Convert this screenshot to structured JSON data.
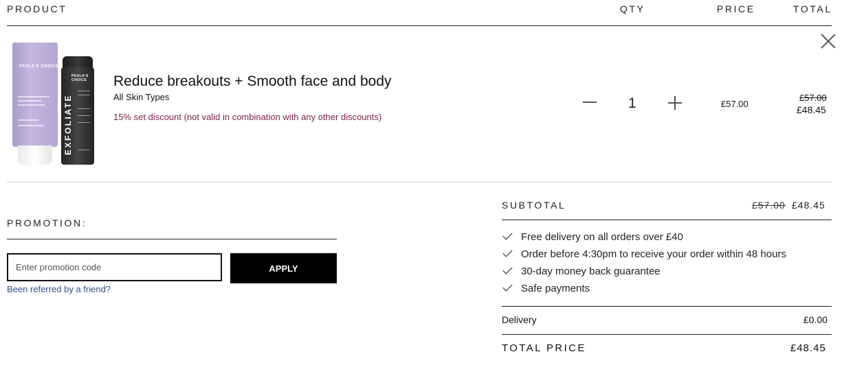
{
  "headers": {
    "product": "PRODUCT",
    "qty": "QTY",
    "price": "PRICE",
    "total": "TOTAL"
  },
  "item": {
    "name": "Reduce breakouts + Smooth face and body",
    "subtitle": "All Skin Types",
    "discount_note": "15% set discount (not valid in combination with any other discounts)",
    "quantity": "1",
    "unit_price": "£57.00",
    "total_original": "£57.00",
    "total_discounted": "£48.45",
    "images": {
      "tube_brand": "PAULA'S CHOICE",
      "bottle_brand": "PAULA'S CHOICE",
      "bottle_word": "EXFOLIATE"
    }
  },
  "promotion": {
    "label": "PROMOTION:",
    "placeholder": "Enter promotion code",
    "value": "",
    "apply_label": "APPLY",
    "referral_link": "Been referred by a friend?"
  },
  "summary": {
    "subtotal_label": "SUBTOTAL",
    "subtotal_original": "£57.00",
    "subtotal_discounted": "£48.45",
    "perks": [
      "Free delivery on all orders over £40",
      "Order before 4:30pm to receive your order within 48 hours",
      "30-day money back guarantee",
      "Safe payments"
    ],
    "delivery_label": "Delivery",
    "delivery_value": "£0.00",
    "total_label": "TOTAL PRICE",
    "total_value": "£48.45"
  },
  "colors": {
    "discount_text": "#7a1f4a",
    "link": "#2d4f8f",
    "button": "#000000",
    "tube": "#b2a6d2",
    "bottle": "#2a2a2a"
  }
}
